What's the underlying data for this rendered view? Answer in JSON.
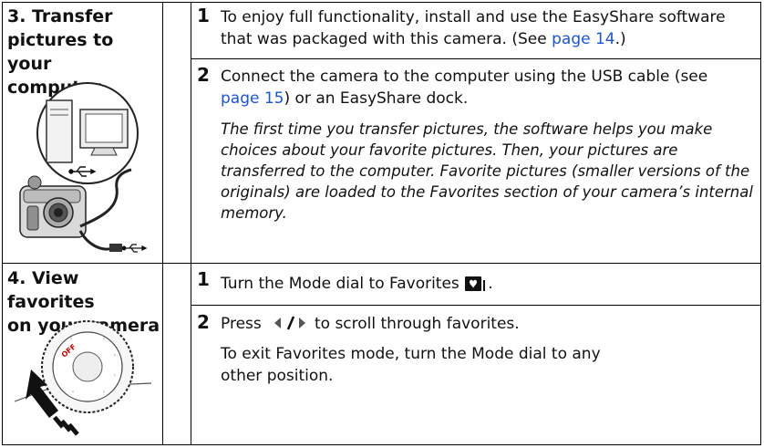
{
  "section3": {
    "title_lines": [
      "3. Transfer",
      "pictures to your",
      "computer"
    ],
    "steps": [
      {
        "number": "1",
        "line1": "To enjoy full functionality, install and use the EasyShare software",
        "line2_pre": "that was packaged with this camera. (See ",
        "line2_link": "page 14",
        "line2_post": ".)"
      },
      {
        "number": "2",
        "line1": "Connect the camera to the computer using the USB cable (see",
        "line2_link": "page 15",
        "line2_post": ") or an EasyShare dock."
      }
    ],
    "note_lines": [
      "The first time you transfer pictures, the software helps you make",
      "choices about your favorite pictures. Then, your pictures are",
      "transferred to the computer. Favorite pictures (smaller versions of the",
      "originals) are loaded to the Favorites section of your camera’s internal",
      "memory."
    ]
  },
  "section4": {
    "title_lines": [
      "4. View favorites",
      "on your camera"
    ],
    "steps": [
      {
        "number": "1",
        "text": "Turn the Mode dial to Favorites",
        "post": "."
      },
      {
        "number": "2",
        "pre": "Press",
        "post": "to scroll through favorites."
      }
    ],
    "note_lines": [
      "To exit Favorites mode, turn the Mode dial to any",
      "other position."
    ]
  },
  "icons": [
    "usb-icon",
    "favorites-icon",
    "left-arrow-icon",
    "right-arrow-icon",
    "off-label"
  ],
  "dial_label": "OFF",
  "colors": {
    "link": "#1a55d9",
    "border": "#000000"
  }
}
